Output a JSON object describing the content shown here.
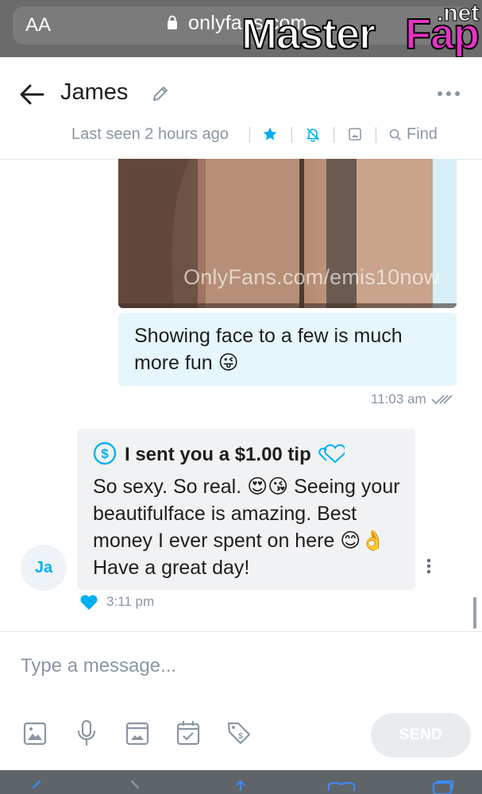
{
  "browser": {
    "aa_label": "AA",
    "url": "onlyfans.com"
  },
  "watermark": {
    "part1": "Master",
    "part2": "Fap",
    "part3": ".net"
  },
  "header": {
    "name": "James",
    "last_seen": "Last seen 2 hours ago",
    "find_label": "Find"
  },
  "messages": {
    "photo_watermark": "OnlyFans.com/emis10now",
    "outgoing_text": "Showing face to a few is much more fun 😜",
    "outgoing_time": "11:03 am",
    "incoming_avatar": "Ja",
    "tip_text": "I sent you a $1.00 tip",
    "incoming_text": "So sexy. So real. 😍😘 Seeing your beautifulface is amazing. Best money I ever spent on here 😊👌 Have a great day!",
    "incoming_time": "3:11 pm"
  },
  "composer": {
    "placeholder": "Type a message...",
    "send_label": "SEND"
  },
  "colors": {
    "accent": "#00aff0",
    "outgoing_bubble": "#e6f6fd",
    "incoming_bubble": "#f1f2f4",
    "muted_text": "#8a96a3"
  }
}
